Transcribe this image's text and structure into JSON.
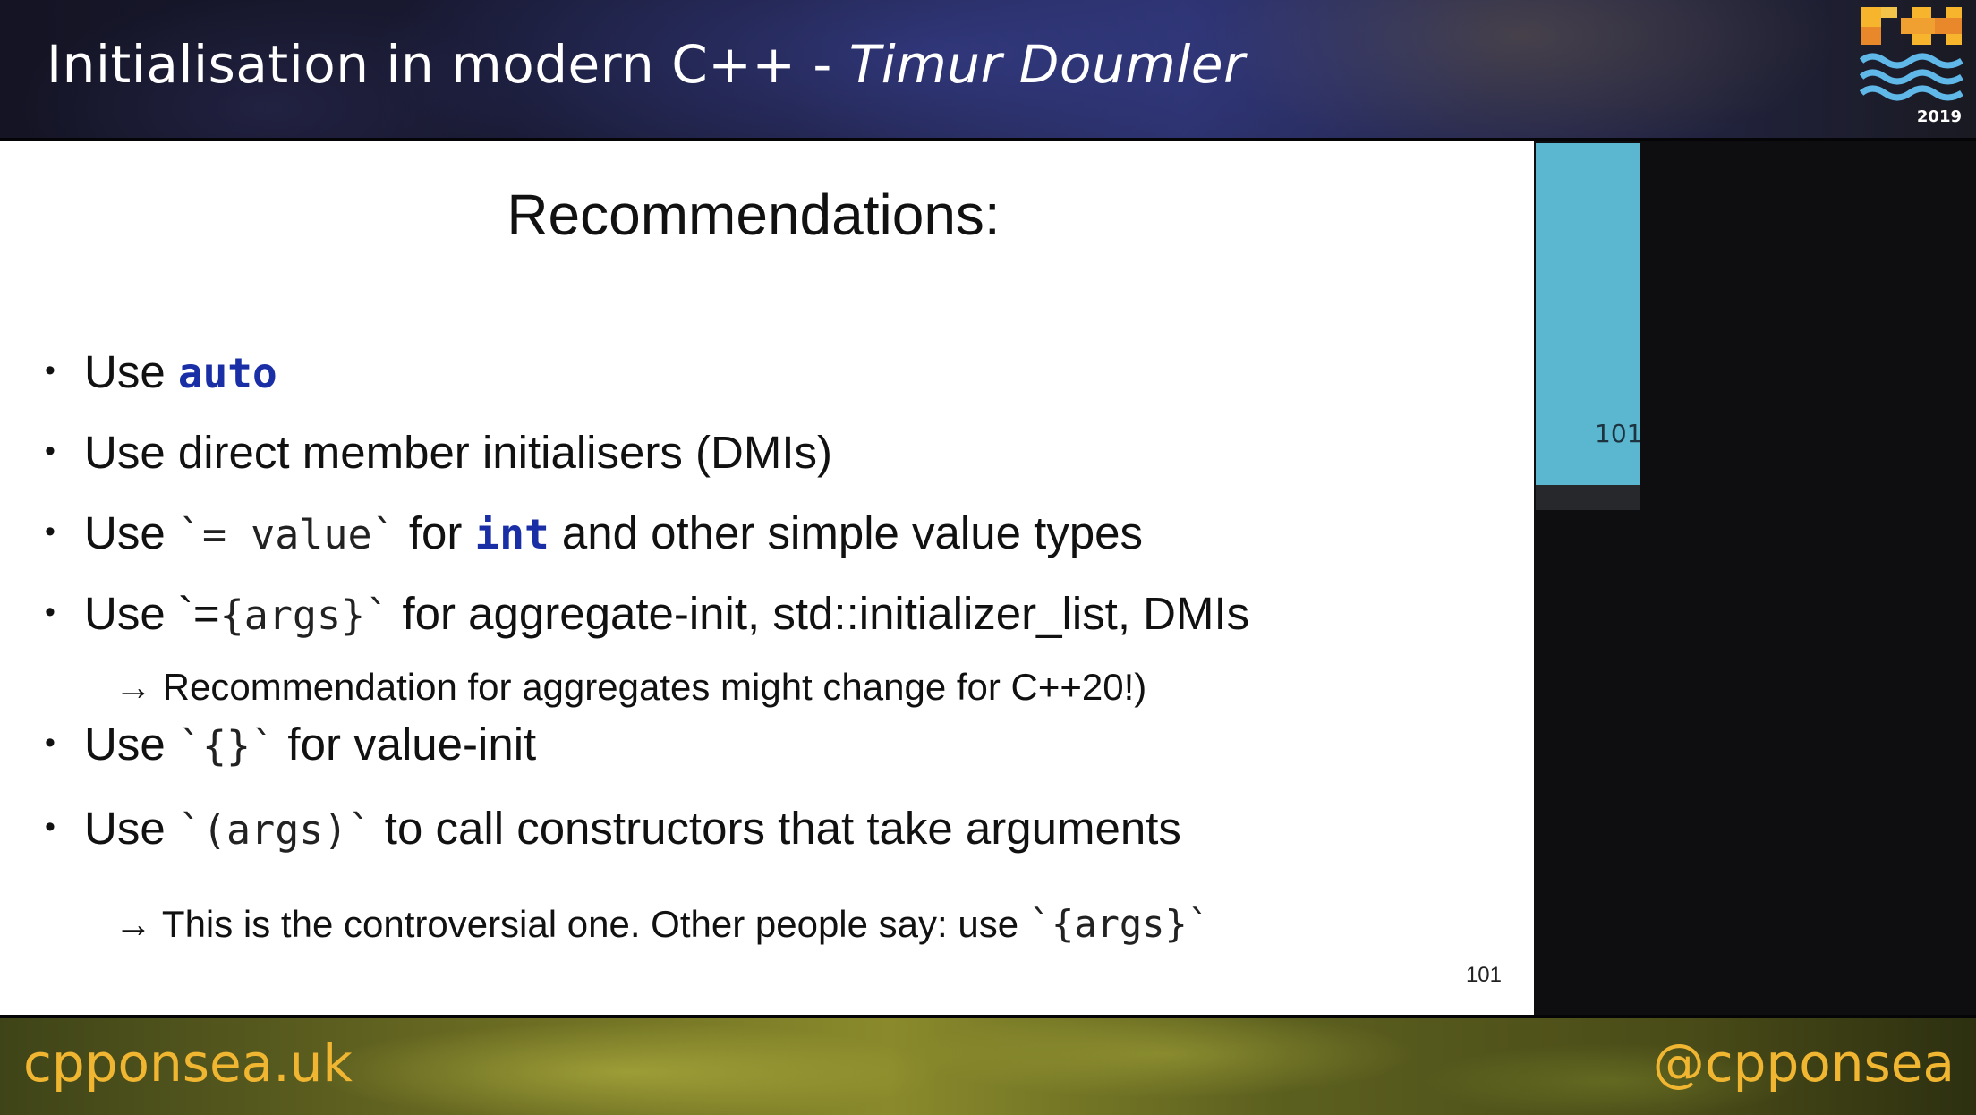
{
  "header": {
    "talk_title": "Initialisation in modern C++ - ",
    "speaker": "Timur Doumler",
    "logo_year": "2019"
  },
  "slide": {
    "title": "Recommendations:",
    "bullet_glyph": "•",
    "arrow_glyph": "→",
    "bullets": [
      {
        "prefix": "Use ",
        "kw": "auto"
      },
      {
        "text": "Use direct member initialisers (DMIs)"
      },
      {
        "prefix": "Use ",
        "code": "`= value`",
        "middle": " for ",
        "kw": "int",
        "suffix": " and other simple value types"
      },
      {
        "prefix": "Use `=",
        "code": "{args}`",
        "suffix": " for aggregate-init, std::initializer_list, DMIs"
      },
      {
        "prefix": "Use ",
        "code": "`{}`",
        "suffix": "  for value-init"
      },
      {
        "prefix": "Use  ",
        "code": "`(args)`",
        "suffix": "  to call constructors that take arguments"
      }
    ],
    "subnotes": [
      {
        "text": " Recommendation for aggregates might change for C++20!)"
      },
      {
        "text": " This is the controversial one. Other people say: use ",
        "code": "`{args}`"
      }
    ],
    "page_number": "101"
  },
  "side_panel": {
    "thumbnail_page": "101",
    "thumbnail_color": "#5bb7d0"
  },
  "footer": {
    "url": "cpponsea.uk",
    "handle": "@cpponsea",
    "text_color": "#f1b631"
  }
}
